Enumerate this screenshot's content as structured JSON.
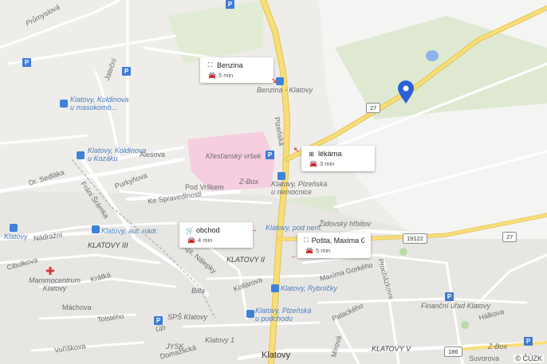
{
  "streets": [
    {
      "text": "Průmyslová",
      "cls": "italic"
    },
    {
      "text": "Jateční",
      "cls": ""
    },
    {
      "text": "Dr. Sedláka",
      "cls": ""
    },
    {
      "text": "Aleśova",
      "cls": ""
    },
    {
      "text": "Purkyňova",
      "cls": ""
    },
    {
      "text": "Pod Vrškem",
      "cls": ""
    },
    {
      "text": "Ke Spravedlnosti",
      "cls": ""
    },
    {
      "text": "Nádražní",
      "cls": ""
    },
    {
      "text": "Cibulkova",
      "cls": ""
    },
    {
      "text": "Krátká",
      "cls": ""
    },
    {
      "text": "Máchova",
      "cls": ""
    },
    {
      "text": "Tolstého",
      "cls": ""
    },
    {
      "text": "Voříškova",
      "cls": ""
    },
    {
      "text": "Domažlická",
      "cls": ""
    },
    {
      "text": "Kpt. Nálepky",
      "cls": ""
    },
    {
      "text": "Kollárova",
      "cls": ""
    },
    {
      "text": "Plzeňská",
      "cls": ""
    },
    {
      "text": "Maxima Gorkého",
      "cls": ""
    },
    {
      "text": "Palackého",
      "cls": ""
    },
    {
      "text": "Procházkova",
      "cls": ""
    },
    {
      "text": "Hálkova",
      "cls": ""
    },
    {
      "text": "Suvorova",
      "cls": ""
    },
    {
      "text": "Mírová",
      "cls": ""
    },
    {
      "text": "Fráni Šrámka",
      "cls": ""
    }
  ],
  "places": [
    {
      "text": "Klatovy, Koldinova\nu masokomb...",
      "cls": "blue italic"
    },
    {
      "text": "Klatovy, Koldinova\nu Kozáku",
      "cls": "blue italic"
    },
    {
      "text": "Benzina - Klatovy",
      "cls": "italic"
    },
    {
      "text": "Křesťanský vršek",
      "cls": "italic"
    },
    {
      "text": "Z-Box",
      "cls": "italic"
    },
    {
      "text": "Klatovy, Plzeňská\nu nemocnice",
      "cls": "italic"
    },
    {
      "text": "Židovský hřbitov",
      "cls": "italic"
    },
    {
      "text": "Klatovy",
      "cls": "blue italic"
    },
    {
      "text": "Klatovy, aut. nádr.",
      "cls": "blue italic"
    },
    {
      "text": "KLATOVY III",
      "cls": "italic dark"
    },
    {
      "text": "Mammocentrum\nKlatovy",
      "cls": "italic"
    },
    {
      "text": "KLATOVY II",
      "cls": "italic dark"
    },
    {
      "text": "Klatovy, pod nem.",
      "cls": "blue italic"
    },
    {
      "text": "Klatovy, Rybníčky",
      "cls": "blue italic"
    },
    {
      "text": "Klatovy, Plzeňská\nu podchodu",
      "cls": "blue italic"
    },
    {
      "text": "Billa",
      "cls": "italic"
    },
    {
      "text": "SPŠ Klatovy",
      "cls": "italic"
    },
    {
      "text": "ÚP",
      "cls": "italic"
    },
    {
      "text": "JYSK",
      "cls": "italic"
    },
    {
      "text": "Klatovy 1",
      "cls": "italic"
    },
    {
      "text": "Klatovy",
      "cls": "big"
    },
    {
      "text": "Finanční úřad Klatovy",
      "cls": "italic"
    },
    {
      "text": "KLATOVY V",
      "cls": "italic dark"
    },
    {
      "text": "Z-Box",
      "cls": "italic"
    }
  ],
  "road_numbers": [
    "27",
    "27",
    "19122",
    "186"
  ],
  "callouts": [
    {
      "name": "Benzina",
      "icon": "network-icon",
      "duration": "5 min"
    },
    {
      "name": "lékárna",
      "icon": "pharmacy-icon",
      "duration": "3 min"
    },
    {
      "name": "obchod",
      "icon": "cart-icon",
      "duration": "4 min"
    },
    {
      "name": "Pošta, Maxima G...",
      "icon": "network-icon",
      "duration": "5 min"
    }
  ],
  "copyright": "© ČÚZK",
  "colors": {
    "pin": "#2a62d6",
    "major_road": "#f5d56b",
    "hospital": "#f7cde0",
    "water": "#8cb4e8",
    "park": "#dfe9d2",
    "parking": "#3f7bd6"
  }
}
